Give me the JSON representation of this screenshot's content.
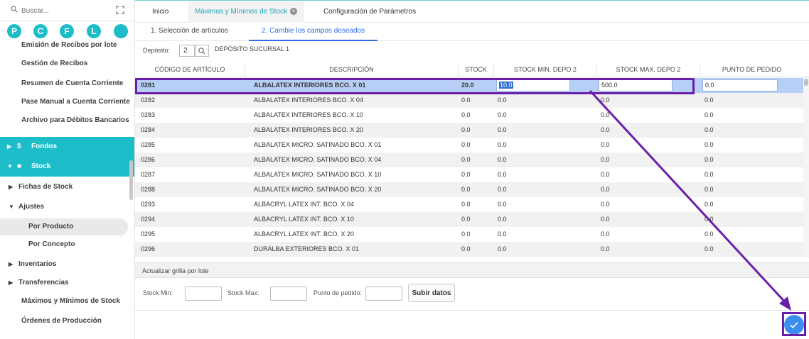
{
  "sidebar": {
    "search_placeholder": "Buscar...",
    "circles": [
      "P",
      "C",
      "F",
      "L",
      ""
    ],
    "items": [
      {
        "label": "Emisión de Recibos por lote"
      },
      {
        "label": "Gestión de Recibos"
      },
      {
        "label": "Resumen de Cuenta Corriente"
      },
      {
        "label": "Pase Manual a Cuenta Corriente"
      },
      {
        "label": "Archivo para Débitos Bancarios"
      },
      {
        "label": "Fondos"
      },
      {
        "label": "Stock"
      },
      {
        "label": "Fichas de Stock"
      },
      {
        "label": "Ajustes"
      },
      {
        "label": "Por Producto"
      },
      {
        "label": "Por Concepto"
      },
      {
        "label": "Inventarios"
      },
      {
        "label": "Transferencias"
      },
      {
        "label": "Máximos y Mínimos de Stock"
      },
      {
        "label": "Órdenes de Producción"
      }
    ]
  },
  "tabs": [
    {
      "label": "Inicio"
    },
    {
      "label": "Máximos y Mínimos de Stock"
    },
    {
      "label": "Configuración de Parámetros"
    }
  ],
  "subtabs": [
    {
      "label": "1. Selección de artículos"
    },
    {
      "label": "2. Cambie los campos deseados"
    }
  ],
  "deposito": {
    "label": "Depósito:",
    "code": "2",
    "name": "DEPÓSITO SUCURSAL 1"
  },
  "grid": {
    "columns": [
      "CÓDIGO DE ARTÍCULO",
      "DESCRIPCIÓN",
      "STOCK",
      "STOCK MIN. DEPO 2",
      "STOCK MAX. DEPO 2",
      "PUNTO DE PEDIDO"
    ],
    "rows": [
      {
        "code": "0281",
        "desc": "ALBALATEX INTERIORES BCO. X 01",
        "stock": "20.0",
        "min": "10.0",
        "max": "500.0",
        "pp": "0.0"
      },
      {
        "code": "0282",
        "desc": "ALBALATEX INTERIORES BCO. X 04",
        "stock": "0.0",
        "min": "0.0",
        "max": "0.0",
        "pp": "0.0"
      },
      {
        "code": "0283",
        "desc": "ALBALATEX INTERIORES BCO. X 10",
        "stock": "0.0",
        "min": "0.0",
        "max": "0.0",
        "pp": "0.0"
      },
      {
        "code": "0284",
        "desc": "ALBALATEX INTERIORES BCO. X 20",
        "stock": "0.0",
        "min": "0.0",
        "max": "0.0",
        "pp": "0.0"
      },
      {
        "code": "0285",
        "desc": "ALBALATEX MICRO. SATINADO BCO. X 01",
        "stock": "0.0",
        "min": "0.0",
        "max": "0.0",
        "pp": "0.0"
      },
      {
        "code": "0286",
        "desc": "ALBALATEX MICRO. SATINADO BCO. X 04",
        "stock": "0.0",
        "min": "0.0",
        "max": "0.0",
        "pp": "0.0"
      },
      {
        "code": "0287",
        "desc": "ALBALATEX MICRO. SATINADO BCO. X 10",
        "stock": "0.0",
        "min": "0.0",
        "max": "0.0",
        "pp": "0.0"
      },
      {
        "code": "0288",
        "desc": "ALBALATEX MICRO. SATINADO BCO. X 20",
        "stock": "0.0",
        "min": "0.0",
        "max": "0.0",
        "pp": "0.0"
      },
      {
        "code": "0293",
        "desc": "ALBACRYL LATEX INT. BCO. X 04",
        "stock": "0.0",
        "min": "0.0",
        "max": "0.0",
        "pp": "0.0"
      },
      {
        "code": "0294",
        "desc": "ALBACRYL LATEX INT. BCO. X 10",
        "stock": "0.0",
        "min": "0.0",
        "max": "0.0",
        "pp": "0.0"
      },
      {
        "code": "0295",
        "desc": "ALBACRYL LATEX INT. BCO. X 20",
        "stock": "0.0",
        "min": "0.0",
        "max": "0.0",
        "pp": "0.0"
      },
      {
        "code": "0296",
        "desc": "DURALBA EXTERIORES BCO. X 01",
        "stock": "0.0",
        "min": "0.0",
        "max": "0.0",
        "pp": "0.0"
      }
    ]
  },
  "batch": {
    "title": "Actualizar grilla por lote",
    "min_label": "Stock Min:",
    "max_label": "Stock Max:",
    "pp_label": "Punto de pedido:",
    "button": "Subir datos"
  },
  "confirm": {
    "icon": "check-icon"
  },
  "colors": {
    "teal": "#1cbcc9",
    "selected_row": "#b7cff6",
    "annotation": "#6a1fa8",
    "accent_blue": "#2e6ee0"
  }
}
